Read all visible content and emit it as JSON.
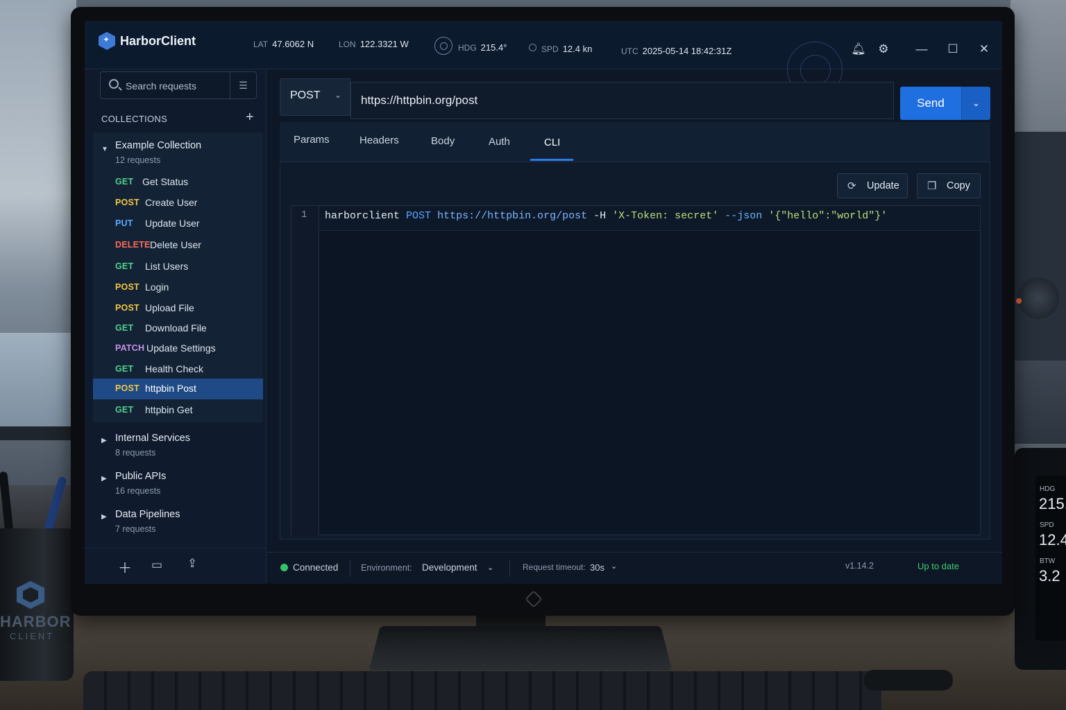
{
  "app": {
    "title": "HarborClient"
  },
  "nav": {
    "lat_label": "LAT",
    "lat_value": "47.6062 N",
    "lon_label": "LON",
    "lon_value": "122.3321 W",
    "hdg_label": "HDG",
    "hdg_value": "215.4°",
    "spd_label": "SPD",
    "spd_value": "12.4 kn",
    "utc_label": "UTC",
    "utc_value": "2025-05-14 18:42:31Z"
  },
  "sidebar": {
    "search_placeholder": "Search requests",
    "collections_header": "COLLECTIONS",
    "collections": [
      {
        "name": "Example Collection",
        "count": "12 requests",
        "expanded": true,
        "requests": [
          {
            "method": "GET",
            "name": "Get Status"
          },
          {
            "method": "POST",
            "name": "Create User"
          },
          {
            "method": "PUT",
            "name": "Update User"
          },
          {
            "method": "DELETE",
            "name": "Delete User"
          },
          {
            "method": "GET",
            "name": "List Users"
          },
          {
            "method": "POST",
            "name": "Login"
          },
          {
            "method": "POST",
            "name": "Upload File"
          },
          {
            "method": "GET",
            "name": "Download File"
          },
          {
            "method": "PATCH",
            "name": "Update Settings"
          },
          {
            "method": "GET",
            "name": "Health Check"
          },
          {
            "method": "POST",
            "name": "httpbin Post",
            "active": true
          },
          {
            "method": "GET",
            "name": "httpbin Get"
          }
        ]
      },
      {
        "name": "Internal Services",
        "count": "8 requests"
      },
      {
        "name": "Public APIs",
        "count": "16 requests"
      },
      {
        "name": "Data Pipelines",
        "count": "7 requests"
      }
    ]
  },
  "method_colors": {
    "GET": "#4fd18b",
    "POST": "#f2c744",
    "PUT": "#5aa9ff",
    "DELETE": "#ff6b5a",
    "PATCH": "#c792ea"
  },
  "request": {
    "method": "POST",
    "url": "https://httpbin.org/post",
    "send_label": "Send"
  },
  "tabs": [
    "Params",
    "Headers",
    "Body",
    "Auth",
    "CLI"
  ],
  "active_tab": "CLI",
  "cli": {
    "update_label": "Update",
    "copy_label": "Copy",
    "line_number": "1",
    "tokens": {
      "cmd": "harborclient",
      "method": "POST",
      "url": "https://httpbin.org/post",
      "header_flag": "-H",
      "header_value": "'X-Token: secret'",
      "json_flag": "--json",
      "json_value": "'{\"hello\":\"world\"}'"
    }
  },
  "status": {
    "connection": "Connected",
    "env_label": "Environment:",
    "env_value": "Development",
    "timeout_label": "Request timeout:",
    "timeout_value": "30s",
    "version": "v1.14.2",
    "update_status": "Up to date"
  },
  "scene": {
    "mug_brand": "HARBOR",
    "mug_sub": "CLIENT",
    "instrument": {
      "hdg_label": "HDG",
      "hdg_value": "215.",
      "spd_label": "SPD",
      "spd_value": "12.4",
      "btw_label": "BTW",
      "btw_value": "3.2"
    }
  },
  "colors": {
    "accent": "#1f6fe0",
    "ok": "#34c46b",
    "up_to_date": "#3fcf6e",
    "selection": "#1f4a86"
  }
}
